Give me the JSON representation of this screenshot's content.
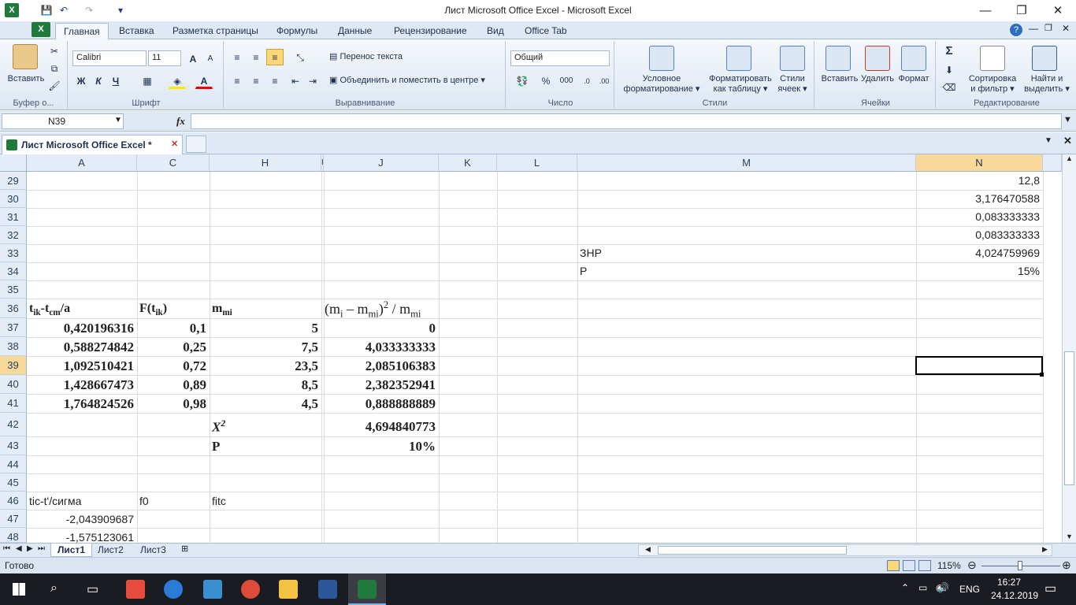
{
  "window": {
    "title": "Лист Microsoft Office Excel - Microsoft Excel",
    "minimize": "—",
    "restore": "❐",
    "close": "✕"
  },
  "ribbon_tabs": [
    "Главная",
    "Вставка",
    "Разметка страницы",
    "Формулы",
    "Данные",
    "Рецензирование",
    "Вид",
    "Office Tab"
  ],
  "ribbon": {
    "clipboard": {
      "paste": "Вставить",
      "label": "Буфер о..."
    },
    "font": {
      "name": "Calibri",
      "size": "11",
      "bold": "Ж",
      "italic": "К",
      "underline": "Ч",
      "grow": "A",
      "shrink": "A",
      "label": "Шрифт"
    },
    "alignment": {
      "wrap": "Перенос текста",
      "merge": "Объединить и поместить в центре",
      "label": "Выравнивание"
    },
    "number": {
      "format": "Общий",
      "percent": "%",
      "thousands": "000",
      "label": "Число"
    },
    "styles": {
      "conditional": "Условное\nформатирование",
      "conditional_l1": "Условное",
      "conditional_l2": "форматирование",
      "table_l1": "Форматировать",
      "table_l2": "как таблицу",
      "cell_l1": "Стили",
      "cell_l2": "ячеек",
      "label": "Стили"
    },
    "cells": {
      "insert": "Вставить",
      "delete": "Удалить",
      "format": "Формат",
      "label": "Ячейки"
    },
    "editing": {
      "sigma": "Σ",
      "sort_l1": "Сортировка",
      "sort_l2": "и фильтр",
      "find_l1": "Найти и",
      "find_l2": "выделить",
      "label": "Редактирование"
    }
  },
  "formula_bar": {
    "name_box": "N39",
    "fx": "fx",
    "formula": ""
  },
  "workbook_tab": "Лист Microsoft Office Excel *",
  "columns": [
    "A",
    "C",
    "H",
    "I",
    "J",
    "K",
    "L",
    "M",
    "N"
  ],
  "rows": [
    "29",
    "30",
    "31",
    "32",
    "33",
    "34",
    "35",
    "36",
    "37",
    "38",
    "39",
    "40",
    "41",
    "42",
    "43",
    "44",
    "45",
    "46",
    "47",
    "48"
  ],
  "cells": {
    "N29": "12,8",
    "N30": "3,176470588",
    "N31": "0,083333333",
    "N32": "0,083333333",
    "M33": "ЗНР",
    "N33": "4,024759969",
    "M34": "P",
    "N34": "15%",
    "A36_t": "t",
    "A36_ik": "ik",
    "A36_dash": "-t",
    "A36_cm": "cm",
    "A36_tail": "/a",
    "C36_F": "F(t",
    "C36_ik": "ik",
    "C36_tail": ")",
    "H36_m": "m",
    "H36_mi": "mi",
    "J36_open": "(m",
    "J36_i": "i",
    "J36_mid": " – m",
    "J36_mi": "mi",
    "J36_close": ")",
    "J36_sq": "2",
    "J36_div": " / m",
    "J36_mi2": "mi",
    "A37": "0,420196316",
    "C37": "0,1",
    "H37": "5",
    "J37": "0",
    "A38": "0,588274842",
    "C38": "0,25",
    "H38": "7,5",
    "J38": "4,033333333",
    "A39": "1,092510421",
    "C39": "0,72",
    "H39": "23,5",
    "J39": "2,085106383",
    "A40": "1,428667473",
    "C40": "0,89",
    "H40": "8,5",
    "J40": "2,382352941",
    "A41": "1,764824526",
    "C41": "0,98",
    "H41": "4,5",
    "J41": "0,888888889",
    "H42_x": "X",
    "H42_sq": "2",
    "J42": "4,694840773",
    "H43": "P",
    "J43": "10%",
    "A46": "tic-t'/сигма",
    "C46": "f0",
    "H46": "fitc",
    "A47": "-2,043909687",
    "A48": "-1,575123061"
  },
  "sheets": [
    "Лист1",
    "Лист2",
    "Лист3"
  ],
  "status": {
    "ready": "Готово",
    "zoom": "115%"
  },
  "taskbar": {
    "lang": "ENG",
    "time": "16:27",
    "date": "24.12.2019"
  }
}
